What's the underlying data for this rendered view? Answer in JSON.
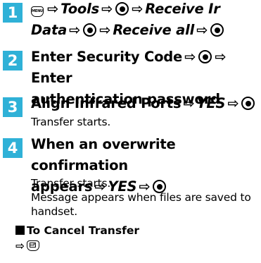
{
  "steps": [
    {
      "number": "1",
      "line1": {
        "menu_key": "MENU",
        "tools": "Tools",
        "receive_ir": "Receive Ir"
      },
      "line2": {
        "data": "Data",
        "receive_all": "Receive all"
      }
    },
    {
      "number": "2",
      "line1": {
        "enter_security": "Enter Security Code",
        "enter": "Enter"
      },
      "line2": {
        "auth": "authentication password"
      }
    },
    {
      "number": "3",
      "line1": {
        "align": "Align Infrared Ports",
        "yes": "YES"
      },
      "note": "Transfer starts."
    },
    {
      "number": "4",
      "line1": "When an overwrite confirmation",
      "line2": {
        "appears": "appears",
        "yes": "YES"
      },
      "notes": [
        "Transfer starts.",
        "Message appears when files are saved to",
        "handset."
      ]
    }
  ],
  "cancel": {
    "title": "To Cancel Transfer"
  },
  "symbols": {
    "arrow": "⇨"
  },
  "colors": {
    "step_badge": "#2fb1d7",
    "text": "#000000"
  }
}
